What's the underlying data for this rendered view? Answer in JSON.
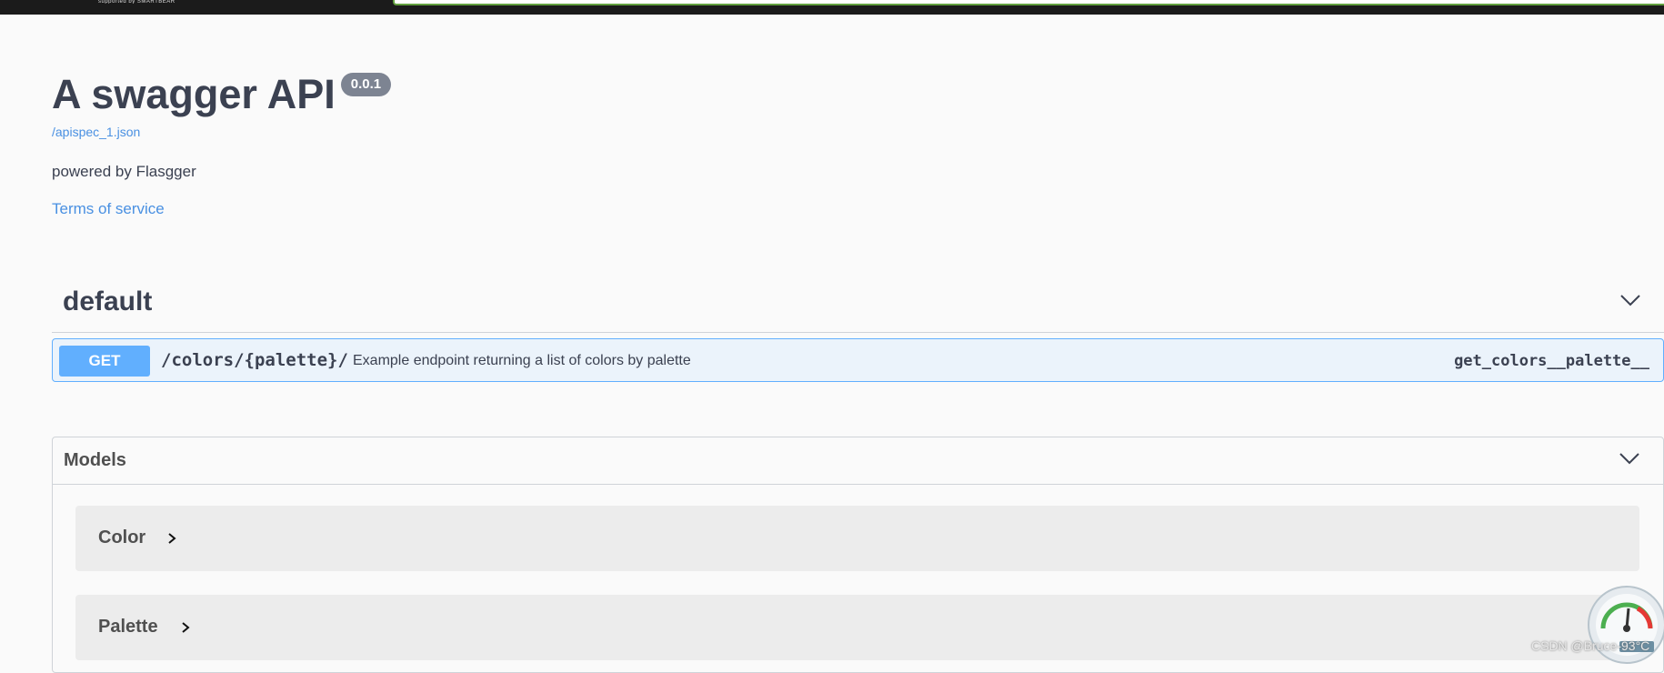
{
  "topbar": {
    "subtitle": "supported by SMARTBEAR"
  },
  "info": {
    "title": "A swagger API",
    "version": "0.0.1",
    "spec_url": "/apispec_1.json",
    "description": "powered by Flasgger",
    "terms_label": "Terms of service"
  },
  "tag": {
    "name": "default",
    "chevron_icon": "chevron-down-icon"
  },
  "operation": {
    "method": "GET",
    "path": "/colors/{palette}/",
    "summary": "Example endpoint returning a list of colors by palette",
    "operation_id": "get_colors__palette__",
    "color": "#61affe"
  },
  "models": {
    "title": "Models",
    "items": [
      {
        "name": "Color"
      },
      {
        "name": "Palette"
      }
    ]
  },
  "overlay": {
    "watermark": "CSDN @Bruce-93°C"
  }
}
